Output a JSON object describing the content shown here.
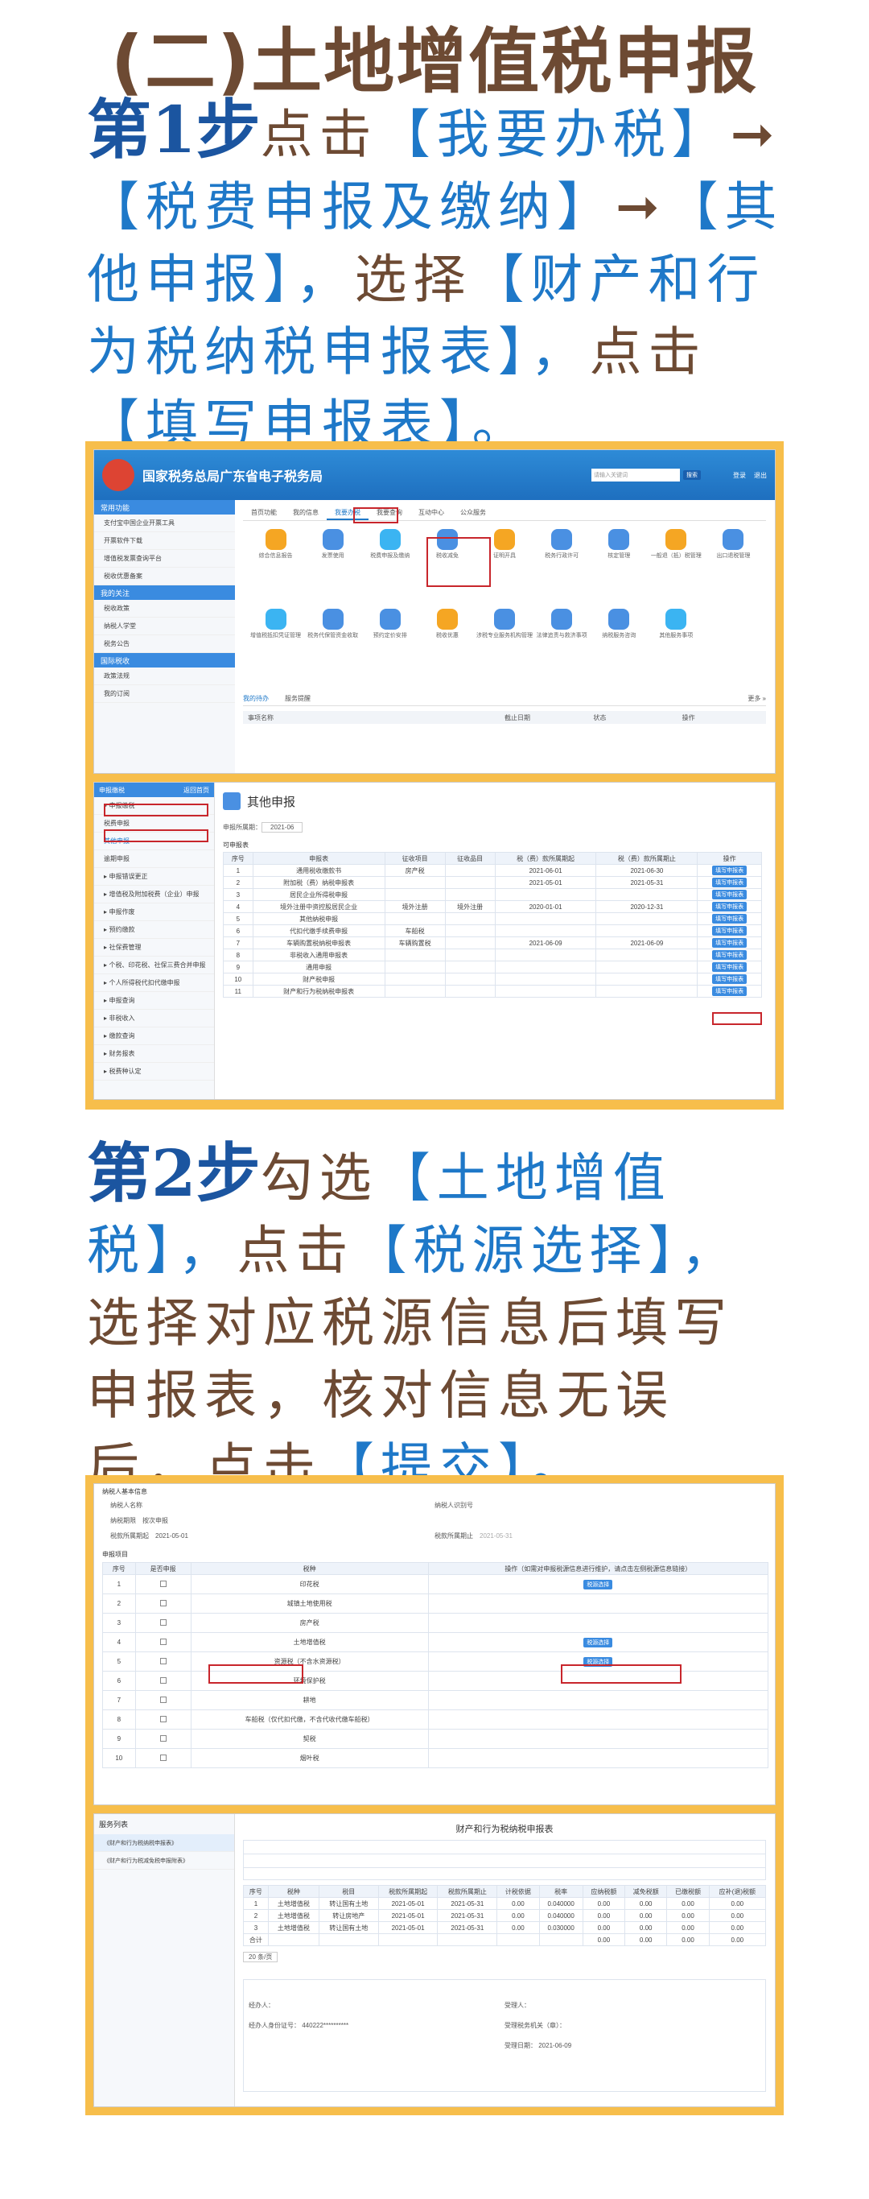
{
  "heading": "(二)土地增值税申报",
  "step1": {
    "num": "第1步",
    "t1": "点击",
    "t2": "【我要办税】",
    "arrow": "➞",
    "t3": "【税费申报及缴纳】",
    "t4": "➞",
    "t5": "【其他申报】，",
    "t6": "选择",
    "t7": "【财产和行为税纳税申报表】，",
    "t8": "点击",
    "t9": "【填写申报表】。"
  },
  "step2": {
    "num": "第2步",
    "t1": "勾选",
    "t2": "【土地增值税】，",
    "t3": "点击",
    "t4": "【税源选择】，",
    "t5": "选择对应税源信息后填写申报表，核对信息无误后，点击",
    "t6": "【提交】。"
  },
  "shot1": {
    "site_title": "国家税务总局广东省电子税务局",
    "search_placeholder": "请输入关键词",
    "search_btn": "搜索",
    "user": "登录",
    "exit": "退出",
    "sidebar": [
      {
        "h": "常用功能"
      },
      {
        "i": "支付宝中国企业开票工具"
      },
      {
        "i": "开票软件下载"
      },
      {
        "i": "增值税发票查询平台"
      },
      {
        "i": "税收优惠备案"
      },
      {
        "h": "我的关注"
      },
      {
        "i": "税收政策"
      },
      {
        "i": "纳税人学堂"
      },
      {
        "i": "税务公告"
      },
      {
        "h": "国际税收"
      },
      {
        "i": "政策法规"
      },
      {
        "i": "我的订阅"
      }
    ],
    "tabs": [
      "首页功能",
      "我的信息",
      "我要办税",
      "我要查询",
      "互动中心",
      "公众服务"
    ],
    "icons": [
      "综合信息报告",
      "发票使用",
      "税费申报及缴纳",
      "税收减免",
      "证明开具",
      "税务行政许可",
      "核定管理",
      "一般退（抵）税管理",
      "出口退税管理",
      "增值税抵扣凭证管理",
      "税务代保管资金收取",
      "预约定价安排",
      "税收优惠",
      "涉税专业服务机构管理",
      "法律追责与救济事项",
      "纳税服务咨询",
      "其他服务事项"
    ],
    "todo": "我的待办",
    "notice": "服务提醒",
    "more": "更多 »",
    "cols": [
      "事项名称",
      "截止日期",
      "状态",
      "操作"
    ]
  },
  "shot2": {
    "side_title": "申报缴税",
    "side_back": "返回首页",
    "side": [
      "申报缴税",
      "税费申报",
      "其他申报",
      "逾期申报",
      "申报错误更正",
      "增值税及附加税费（企业）申报",
      "申报作废",
      "预约缴款",
      "社保费管理",
      "个税、印花税、社保三费合并申报",
      "个人所得税代扣代缴申报",
      "申报查询",
      "非税收入",
      "缴款查询",
      "财务报表",
      "税费种认定"
    ],
    "page_title": "其他申报",
    "period_label": "申报所属期：",
    "period": "2021-06",
    "list_title": "可申报表",
    "cols": [
      "序号",
      "申报表",
      "征收项目",
      "征收品目",
      "税（费）款所属期起",
      "税（费）款所属期止",
      "操作"
    ],
    "rows": [
      [
        "1",
        "通用税收缴款书",
        "房产税",
        "",
        "2021-06-01",
        "2021-06-30"
      ],
      [
        "2",
        "附加税（费）纳税申报表",
        "",
        "",
        "2021-05-01",
        "2021-05-31"
      ],
      [
        "3",
        "居民企业所得税申报",
        "",
        "",
        "",
        ""
      ],
      [
        "4",
        "境外注册中资控股居民企业",
        "境外注册",
        "境外注册",
        "2020-01-01",
        "2020-12-31"
      ],
      [
        "5",
        "其他纳税申报",
        "",
        "",
        "",
        ""
      ],
      [
        "6",
        "代扣代缴手续费申报",
        "车船税",
        "",
        "",
        ""
      ],
      [
        "7",
        "车辆购置税纳税申报表",
        "车辆购置税",
        "",
        "2021-06-09",
        "2021-06-09"
      ],
      [
        "8",
        "非税收入通用申报表",
        "",
        "",
        "",
        ""
      ],
      [
        "9",
        "通用申报",
        "",
        "",
        "",
        ""
      ],
      [
        "10",
        "财产税申报",
        "",
        "",
        "",
        ""
      ],
      [
        "11",
        "财产和行为税纳税申报表",
        "",
        "",
        "",
        ""
      ]
    ],
    "op_btn": "填写申报表"
  },
  "shot3": {
    "taxpayer_title": "纳税人基本信息",
    "taxpayer_id": "纳税人识别号",
    "taxpayer_name": "纳税人名称",
    "taxpayer_type": "纳税期限",
    "period_type": "按次申报",
    "start_label": "税款所属期起",
    "start": "2021-05-01",
    "end_label": "税款所属期止",
    "end": "2021-05-31",
    "section": "申报项目",
    "cols": [
      "序号",
      "是否申报",
      "税种",
      "操作（如需对申报税源信息进行维护，请点击左侧税源信息链接）"
    ],
    "rows": [
      [
        "1",
        "",
        "印花税"
      ],
      [
        "2",
        "",
        "城镇土地使用税"
      ],
      [
        "3",
        "",
        "房产税"
      ],
      [
        "4",
        "",
        "土地增值税"
      ],
      [
        "5",
        "",
        "资源税（不含水资源税）"
      ],
      [
        "6",
        "",
        "环境保护税"
      ],
      [
        "7",
        "",
        "耕地"
      ],
      [
        "8",
        "",
        "车船税（仅代扣代缴，不含代收代缴车船税）"
      ],
      [
        "9",
        "",
        "契税"
      ],
      [
        "10",
        "",
        "烟叶税"
      ]
    ],
    "src_btn": "税源选择"
  },
  "shot4": {
    "side_title": "服务列表",
    "side_items": [
      "《财产和行为税纳税申报表》",
      "《财产和行为税减免税申报附表》"
    ],
    "doc_title": "财产和行为税纳税申报表",
    "cols": [
      "序号",
      "税种",
      "税目",
      "税款所属期起",
      "税款所属期止",
      "计税依据",
      "税率",
      "应纳税额",
      "减免税额",
      "已缴税额",
      "应补(退)税额"
    ],
    "rows": [
      [
        "1",
        "土地增值税",
        "转让国有土地",
        "2021-05-01",
        "2021-05-31",
        "0.00",
        "0.040000",
        "0.00",
        "0.00",
        "0.00",
        "0.00"
      ],
      [
        "2",
        "土地增值税",
        "转让房地产",
        "2021-05-01",
        "2021-05-31",
        "0.00",
        "0.040000",
        "0.00",
        "0.00",
        "0.00",
        "0.00"
      ],
      [
        "3",
        "土地增值税",
        "转让国有土地",
        "2021-05-01",
        "2021-05-31",
        "0.00",
        "0.030000",
        "0.00",
        "0.00",
        "0.00",
        "0.00"
      ],
      [
        "合计",
        "",
        "",
        "",
        "",
        "",
        "",
        "0.00",
        "0.00",
        "0.00",
        "0.00"
      ]
    ],
    "page_size": "20 条/页",
    "agent": "经办人：",
    "agent_id": "经办人身份证号：",
    "agent_id_val": "440222**********",
    "date": "2021-06-09",
    "accept": "受理人：",
    "accept_org": "受理税务机关（章）：",
    "accept_date": "受理日期："
  }
}
